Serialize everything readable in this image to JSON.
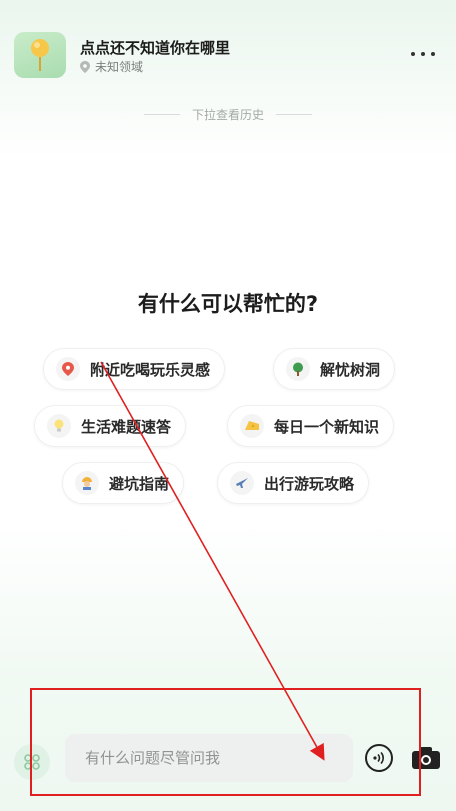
{
  "header": {
    "title": "点点还不知道你在哪里",
    "location": "未知领域"
  },
  "history_hint": "下拉查看历史",
  "help_title": "有什么可以帮忙的?",
  "chips": [
    {
      "label": "附近吃喝玩乐灵感",
      "icon": "pin-icon"
    },
    {
      "label": "解忧树洞",
      "icon": "tree-icon"
    },
    {
      "label": "生活难题速答",
      "icon": "lightbulb-icon"
    },
    {
      "label": "每日一个新知识",
      "icon": "cheese-icon"
    },
    {
      "label": "避坑指南",
      "icon": "worker-icon"
    },
    {
      "label": "出行游玩攻略",
      "icon": "airplane-icon"
    }
  ],
  "input": {
    "placeholder": "有什么问题尽管问我"
  },
  "colors": {
    "annotation_red": "#e02020",
    "brand_green": "#a9dcb0"
  }
}
